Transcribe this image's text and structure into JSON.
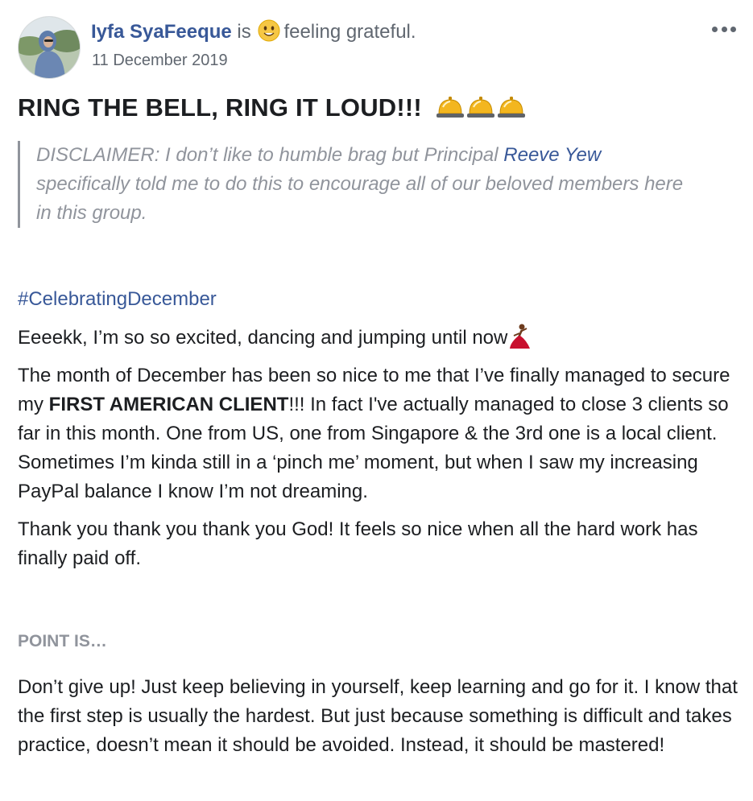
{
  "author": {
    "name": "Iyfa SyaFeeque",
    "is_word": "is",
    "feeling": "feeling grateful.",
    "feeling_icon": "smiling-face-emoji",
    "date": "11 December 2019"
  },
  "menu": {
    "icon": "more-options-icon"
  },
  "headline": {
    "text": "RING THE BELL, RING IT LOUD!!!",
    "icon": "bellhop-bell-emoji",
    "icon_count": 3
  },
  "disclaimer": {
    "before": "DISCLAIMER: I don’t like to humble brag but Principal ",
    "mention": "Reeve Yew",
    "after": " specifically told me to do this to encourage all of our beloved members here in this group."
  },
  "hashtag": "#CelebratingDecember",
  "excited_line": {
    "text": "Eeeekk, I’m so so excited, dancing and jumping until now",
    "icon": "dancer-emoji"
  },
  "paragraph_1": {
    "before": "The month of December has been so nice to me that I’ve finally managed to secure my ",
    "bold": "FIRST AMERICAN CLIENT",
    "after": "!!! In fact I've actually managed to close 3 clients so far in this month. One from US, one from Singapore & the 3rd one is a local client. Sometimes I’m kinda still in a ‘pinch me’ moment, but when I saw my increasing PayPal balance I know I’m not dreaming."
  },
  "paragraph_2": "Thank you thank you thank you God! It feels so nice when all the hard work has finally paid off.",
  "section_heading": "POINT IS…",
  "paragraph_3": "Don’t give up! Just keep believing in yourself, keep learning and go for it. I know that the first step is usually the hardest. But just because something is difficult and takes practice, doesn’t mean it should be avoided. Instead, it should be mastered!",
  "colors": {
    "link": "#385898",
    "text": "#1c1e21",
    "muted": "#90949c",
    "secondary": "#606770"
  }
}
